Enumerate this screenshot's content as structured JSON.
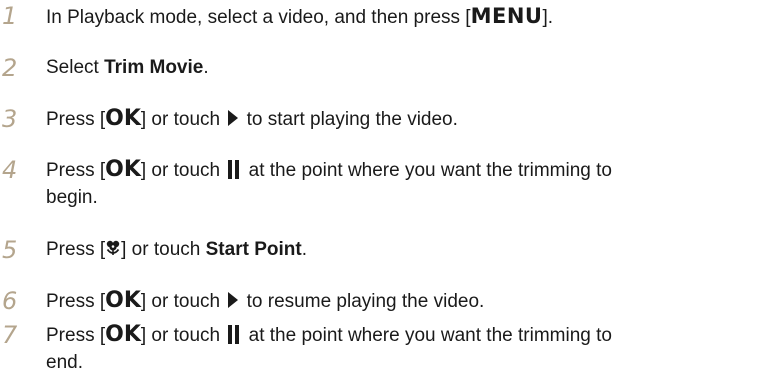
{
  "steps": [
    {
      "number": "1",
      "pre": "In Playback mode, select a video, and then press [",
      "key": "MENU",
      "post": "]."
    },
    {
      "number": "2",
      "pre": "Select ",
      "bold": "Trim Movie",
      "post": "."
    },
    {
      "number": "3",
      "pre": "Press [",
      "key": "OK",
      "mid": "] or touch",
      "icon": "play-icon",
      "post": "to start playing the video."
    },
    {
      "number": "4",
      "pre": "Press [",
      "key": "OK",
      "mid": "] or touch",
      "icon": "pause-icon",
      "post": "at the point where you want the trimming to",
      "line2": "begin."
    },
    {
      "number": "5",
      "pre": "Press [",
      "icon": "macro-flower-icon",
      "mid": "] or touch ",
      "bold": "Start Point",
      "post": "."
    },
    {
      "number": "6",
      "pre": "Press [",
      "key": "OK",
      "mid": "] or touch",
      "icon": "play-icon",
      "post": "to resume playing the video."
    },
    {
      "number": "7",
      "pre": "Press [",
      "key": "OK",
      "mid": "] or touch",
      "icon": "pause-icon",
      "post": "at the point where you want the trimming to",
      "line2": "end."
    }
  ],
  "colors": {
    "step_number": "#b4a58d",
    "text": "#1a1a1a"
  }
}
